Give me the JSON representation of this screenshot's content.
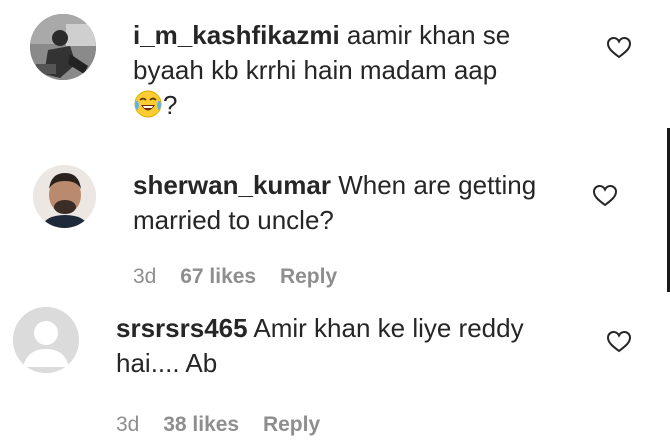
{
  "comments": [
    {
      "username": "i_m_kashfikazmi",
      "text_line1": "aamir khan se",
      "text_line2": "byaah kb krrhi hain madam aap",
      "text_line3": "?",
      "emoji_icon": "face-with-tears-of-joy-emoji"
    },
    {
      "username": "sherwan_kumar",
      "text_line1": "When are getting",
      "text_line2": "married to uncle?",
      "time": "3d",
      "likes": "67 likes",
      "reply": "Reply"
    },
    {
      "username": "srsrsrs465",
      "text_line1": "Amir khan ke liye reddy",
      "text_line2": "hai.... Ab",
      "time": "3d",
      "likes": "38 likes",
      "reply": "Reply"
    }
  ],
  "colors": {
    "text": "#262626",
    "meta": "#8e8e8e",
    "background": "#ffffff"
  }
}
